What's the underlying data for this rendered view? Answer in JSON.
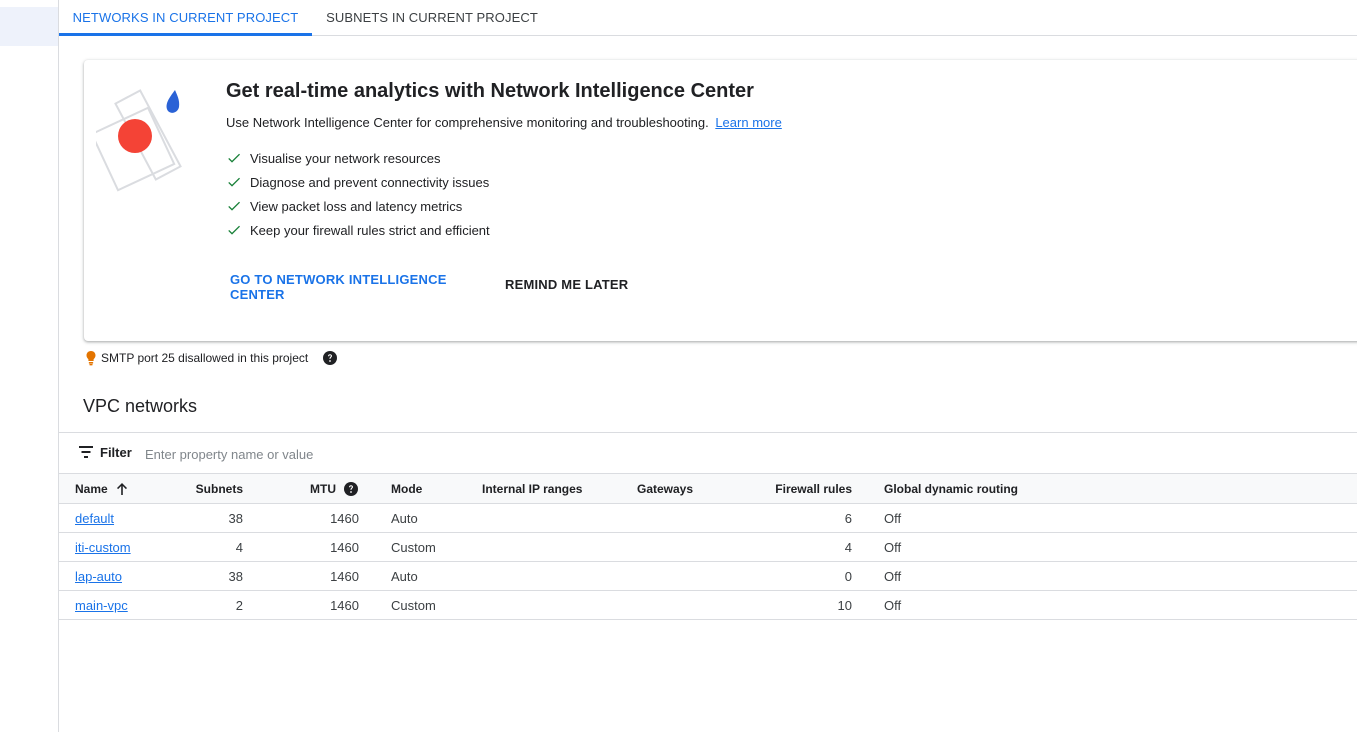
{
  "tabs": [
    {
      "label": "NETWORKS IN CURRENT PROJECT",
      "active": true
    },
    {
      "label": "SUBNETS IN CURRENT PROJECT",
      "active": false
    }
  ],
  "promo": {
    "title": "Get real-time analytics with Network Intelligence Center",
    "description": "Use Network Intelligence Center for comprehensive monitoring and troubleshooting.",
    "learn_more": "Learn more",
    "features": [
      "Visualise your network resources",
      "Diagnose and prevent connectivity issues",
      "View packet loss and latency metrics",
      "Keep your firewall rules strict and efficient"
    ],
    "primary_action": "GO TO NETWORK INTELLIGENCE CENTER",
    "secondary_action": "REMIND ME LATER",
    "colors": {
      "check": "#188038",
      "accent": "#1a73e8",
      "art_red": "#f44336",
      "art_blue": "#2a62d6"
    }
  },
  "smtp_notice": {
    "text": "SMTP port 25 disallowed in this project",
    "icon": "lightbulb-icon",
    "help_icon": "help-icon",
    "icon_color": "#e37400"
  },
  "section_title": "VPC networks",
  "filter": {
    "label": "Filter",
    "placeholder": "Enter property name or value"
  },
  "table": {
    "columns": {
      "name": "Name",
      "subnets": "Subnets",
      "mtu": "MTU",
      "mode": "Mode",
      "internal_ip_ranges": "Internal IP ranges",
      "gateways": "Gateways",
      "firewall_rules": "Firewall rules",
      "global_dynamic_routing": "Global dynamic routing"
    },
    "sort": {
      "column": "Name",
      "direction": "ascending"
    },
    "rows": [
      {
        "name": "default",
        "subnets": "38",
        "mtu": "1460",
        "mode": "Auto",
        "internal_ip_ranges": "",
        "gateways": "",
        "firewall_rules": "6",
        "global_dynamic_routing": "Off"
      },
      {
        "name": "iti-custom",
        "subnets": "4",
        "mtu": "1460",
        "mode": "Custom",
        "internal_ip_ranges": "",
        "gateways": "",
        "firewall_rules": "4",
        "global_dynamic_routing": "Off"
      },
      {
        "name": "lap-auto",
        "subnets": "38",
        "mtu": "1460",
        "mode": "Auto",
        "internal_ip_ranges": "",
        "gateways": "",
        "firewall_rules": "0",
        "global_dynamic_routing": "Off"
      },
      {
        "name": "main-vpc",
        "subnets": "2",
        "mtu": "1460",
        "mode": "Custom",
        "internal_ip_ranges": "",
        "gateways": "",
        "firewall_rules": "10",
        "global_dynamic_routing": "Off"
      }
    ]
  }
}
